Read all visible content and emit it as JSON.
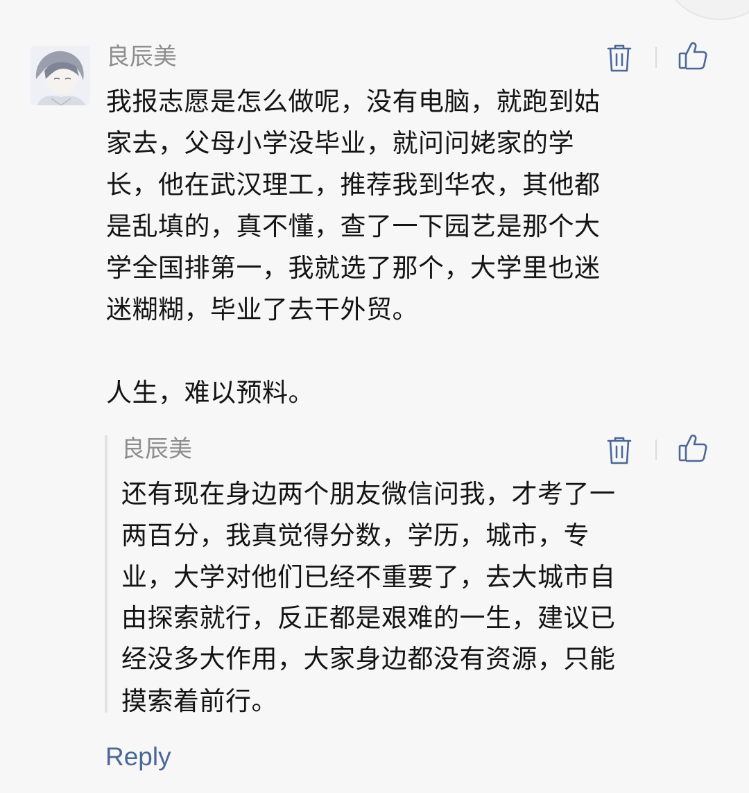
{
  "comment": {
    "author": "良辰美",
    "lines": [
      "我报志愿是怎么做呢，没有电脑，就跑到姑",
      "家去，父母小学没毕业，就问问姥家的学",
      "长，他在武汉理工，推荐我到华农，其他都",
      "是乱填的，真不懂，查了一下园艺是那个大",
      "学全国排第一，我就选了那个，大学里也迷",
      "迷糊糊，毕业了去干外贸。",
      "",
      "人生，难以预料。"
    ],
    "icons": {
      "delete": "trash-icon",
      "like": "thumbs-up-icon"
    }
  },
  "reply": {
    "author": "良辰美",
    "lines": [
      "还有现在身边两个朋友微信问我，才考了一",
      "两百分，我真觉得分数，学历，城市，专",
      "业，大学对他们已经不重要了，去大城市自",
      "由探索就行，反正都是艰难的一生，建议已",
      "经没多大作用，大家身边都没有资源，只能",
      "摸索着前行。"
    ],
    "icons": {
      "delete": "trash-icon",
      "like": "thumbs-up-icon"
    }
  },
  "reply_link": "Reply",
  "colors": {
    "background": "#f7f7f7",
    "author": "#8e8e8e",
    "text": "#141414",
    "icon": "#4a6795",
    "link": "#4a6795"
  }
}
